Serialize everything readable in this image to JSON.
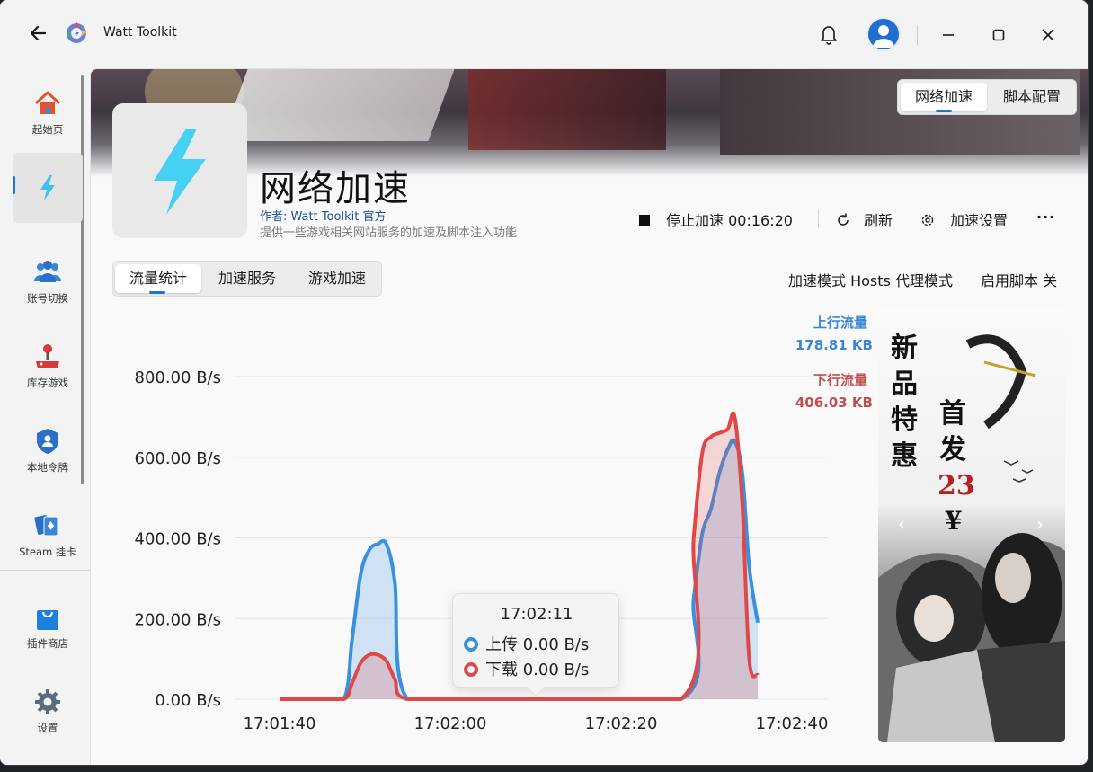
{
  "app": {
    "title": "Watt Toolkit"
  },
  "sidebar": {
    "items": [
      {
        "label": "起始页",
        "icon": "home-icon"
      },
      {
        "label": "",
        "icon": "lightning-icon"
      },
      {
        "label": "账号切换",
        "icon": "users-icon"
      },
      {
        "label": "库存游戏",
        "icon": "joystick-icon"
      },
      {
        "label": "本地令牌",
        "icon": "shield-user-icon"
      },
      {
        "label": "Steam 挂卡",
        "icon": "cards-icon"
      },
      {
        "label": "插件商店",
        "icon": "store-bag-icon"
      },
      {
        "label": "设置",
        "icon": "gear-icon"
      }
    ]
  },
  "top_segment": {
    "options": [
      "网络加速",
      "脚本配置"
    ],
    "selected": "网络加速"
  },
  "header": {
    "title": "网络加速",
    "author": "作者: Watt Toolkit 官方",
    "description": "提供一些游戏相关网站服务的加速及脚本注入功能"
  },
  "actions": {
    "stop": "停止加速 00:16:20",
    "refresh": "刷新",
    "settings": "加速设置",
    "more": "···"
  },
  "tabs": {
    "options": [
      "流量统计",
      "加速服务",
      "游戏加速"
    ],
    "selected": "流量统计"
  },
  "status": {
    "mode": "加速模式 Hosts 代理模式",
    "script": "启用脚本 关"
  },
  "legend": {
    "upload_label": "上行流量",
    "upload_value": "178.81 KB",
    "download_label": "下行流量",
    "download_value": "406.03 KB"
  },
  "tooltip": {
    "time": "17:02:11",
    "upload": "上传  0.00 B/s",
    "download": "下载  0.00 B/s"
  },
  "ad": {
    "lines": [
      "新品特惠",
      "首发",
      "23",
      "¥"
    ]
  },
  "colors": {
    "upload": "#3a90e0",
    "download": "#e04848",
    "accent": "#2570d4"
  },
  "chart_data": {
    "type": "area",
    "y_tick_labels": [
      "0.00 B/s",
      "200.00 B/s",
      "400.00 B/s",
      "600.00 B/s",
      "800.00 B/s"
    ],
    "x_tick_labels": [
      "17:01:40",
      "17:02:00",
      "17:02:20",
      "17:02:40"
    ],
    "ylim": [
      0,
      900
    ],
    "xlim_seconds": [
      0,
      60
    ],
    "series": [
      {
        "name": "上行流量",
        "x": [
          0,
          4,
          7.5,
          8.5,
          9.5,
          10.5,
          11.5,
          12.5,
          13.5,
          15,
          25,
          47,
          48.5,
          49.5,
          50.5,
          51.5,
          52.5,
          53.3,
          54.2,
          55,
          56
        ],
        "values": [
          0,
          0,
          0,
          150,
          310,
          370,
          385,
          385,
          290,
          0,
          0,
          0,
          250,
          410,
          470,
          560,
          620,
          640,
          560,
          330,
          190
        ]
      },
      {
        "name": "下行流量",
        "x": [
          0,
          4,
          7.5,
          8.5,
          9.5,
          10.5,
          11.5,
          12.5,
          13.5,
          15,
          25,
          47,
          48.5,
          49.5,
          50.5,
          51.5,
          52.5,
          53.3,
          54.2,
          55,
          56
        ],
        "values": [
          0,
          0,
          0,
          40,
          90,
          110,
          110,
          95,
          50,
          0,
          0,
          0,
          400,
          610,
          650,
          660,
          670,
          700,
          480,
          100,
          60
        ]
      }
    ]
  }
}
